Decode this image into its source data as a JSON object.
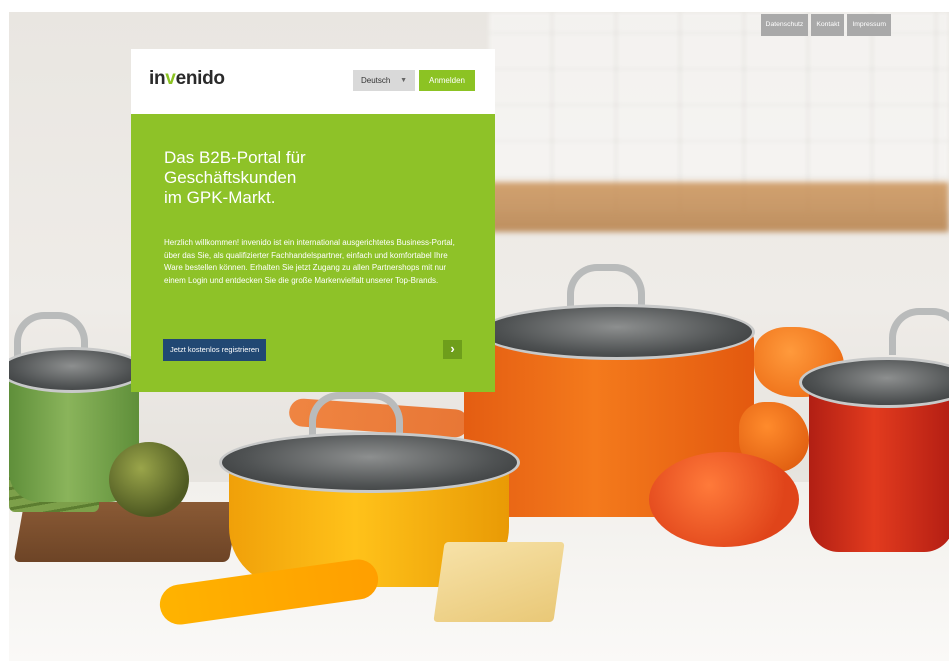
{
  "toplinks": {
    "privacy": "Datenschutz",
    "contact": "Kontakt",
    "imprint": "Impressum"
  },
  "header": {
    "logo_prefix": "in",
    "logo_accent": "v",
    "logo_suffix": "enido",
    "language": "Deutsch",
    "login": "Anmelden"
  },
  "hero": {
    "headline_line1": "Das B2B-Portal für",
    "headline_line2": "Geschäftskunden",
    "headline_line3": "im GPK-Markt.",
    "intro": "Herzlich willkommen! invenido ist ein international ausgerichtetes Business-Portal, über das Sie, als qualifizierter Fachhandelspartner, einfach und komfortabel Ihre Ware bestellen können. Erhalten Sie jetzt Zugang zu allen Partnershops mit nur einem Login und entdecken Sie die große Markenvielfalt unserer Top-Brands.",
    "register": "Jetzt kostenlos registrieren",
    "arrow_icon": "chevron-right-icon"
  },
  "colors": {
    "brand_green": "#8ec228",
    "button_blue": "#214873",
    "toplink_gray": "#a9a9a9"
  }
}
